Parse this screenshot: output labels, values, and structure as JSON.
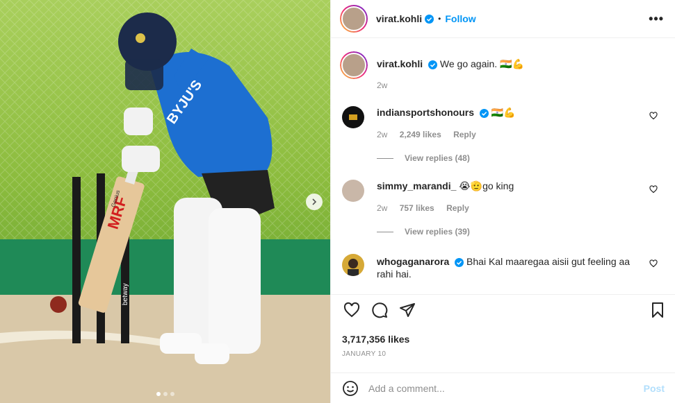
{
  "header": {
    "username": "virat.kohli",
    "bullet": "•",
    "follow_label": "Follow",
    "more_label": "•••"
  },
  "caption": {
    "username": "virat.kohli",
    "text": "We go again. 🇮🇳💪",
    "age": "2w"
  },
  "comments": [
    {
      "username": "indiansportshonours",
      "text": "🇮🇳💪",
      "age": "2w",
      "likes": "2,249 likes",
      "reply_label": "Reply",
      "view_replies": "View replies (48)"
    },
    {
      "username": "simmy_marandi_",
      "text": "😭🫡go king",
      "age": "2w",
      "likes": "757 likes",
      "reply_label": "Reply",
      "view_replies": "View replies (39)"
    },
    {
      "username": "whogaganarora",
      "text": "Bhai Kal maaregaa aisii gut feeling aa rahi hai."
    }
  ],
  "post": {
    "likes": "3,717,356 likes",
    "date": "JANUARY 10"
  },
  "add_comment": {
    "placeholder": "Add a comment...",
    "post_label": "Post"
  },
  "media": {
    "jersey_text": "BYJU'S",
    "bat_brand": "MRF",
    "bat_sub": "Genius",
    "stump_brand": "betway",
    "carousel_total": 3,
    "carousel_active": 1
  },
  "colors": {
    "accent": "#0095f6",
    "verified": "#0095f6",
    "muted": "#8e8e8e",
    "post_disabled": "#b2dffc",
    "jersey": "#1d6fd1"
  }
}
